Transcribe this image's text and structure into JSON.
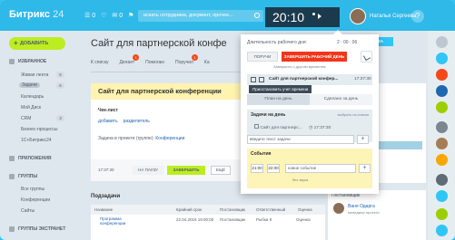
{
  "header": {
    "logo": "Битрикс",
    "logo_num": "24",
    "icons": [
      "☰ 0",
      "♡",
      "✉ 0",
      "⚑"
    ],
    "search_placeholder": "искать сотрудника, документ, прочее...",
    "clock": "20:10",
    "user_name": "Наталья Сергеева",
    "help": "?"
  },
  "sidebar": {
    "add_label": "ДОБАВИТЬ",
    "favorites": "ИЗБРАННОЕ",
    "items": [
      {
        "label": "Живая лента",
        "badge": "5"
      },
      {
        "label": "Задачи",
        "badge": "6"
      },
      {
        "label": "Календарь",
        "badge": ""
      },
      {
        "label": "Мой Диск",
        "badge": ""
      },
      {
        "label": "CRM",
        "badge": "3"
      },
      {
        "label": "Бизнес-процессы",
        "badge": ""
      },
      {
        "label": "1С+Битрикс24",
        "badge": ""
      }
    ],
    "apps": "ПРИЛОЖЕНИЯ",
    "groups": "ГРУППЫ",
    "group_items": [
      "Все группы",
      "Конференции",
      "Сайты"
    ],
    "extranet": "ГРУППЫ ЭКСТРАНЕТ"
  },
  "main": {
    "title": "Сайт для партнерской конфе",
    "tabs": [
      {
        "label": "К списку",
        "count": ""
      },
      {
        "label": "Делает",
        "count": "1"
      },
      {
        "label": "Помогаю",
        "count": ""
      },
      {
        "label": "Поручил",
        "count": "1"
      },
      {
        "label": "Ка",
        "count": ""
      }
    ],
    "task_title": "Сайт для партнерской конференции",
    "checklist": "Чек-лист",
    "add_link": "добавить",
    "separator_link": "разделитель",
    "project_label": "Задача в проекте (группе):",
    "project_name": "Конференции",
    "timer": "17:37:30",
    "pause": "НА ПАУЗУ",
    "finish": "ЗАВЕРШИТЬ",
    "more": "ЕЩЁ",
    "subtasks": "Подзадачи",
    "grid_headers": [
      "Название",
      "Крайний срок",
      "Постановщик",
      "Ответственный",
      "Оценка"
    ],
    "grid_row": {
      "name": "Программа конференции",
      "deadline": "22.04.2016 19:00:00",
      "creator": "Постановщик",
      "assignee": "Рыбка К",
      "score": "Оценка"
    }
  },
  "right": {
    "button": "ЗА",
    "stage": "Ждёт выполнения",
    "creator_label": "Постановщик",
    "creator_name": "Ваня Одарга",
    "creator_role": "менеджер проекта"
  },
  "popup": {
    "duration_label": "Длительность рабочего дня:",
    "duration_value": "2 : 00 : 06",
    "pause": "ПОРУЧИ",
    "finish": "ЗАВЕРШИТЬ РАБОЧИЙ ДЕНЬ",
    "note": "Завершить с другим временем",
    "current_task": "Сайт для партнерской конфер...",
    "current_time": "17:37:30",
    "tooltip": "Приостановить учет времени",
    "tab_plan": "План на день",
    "tab_done": "Сделано за день",
    "tasks_header": "Задачи на день",
    "tasks_select": "выбрать из списка",
    "task_item": "Сайт для партнерс...",
    "task_item_time": "17:37:30",
    "task_input": "введите текст задачи",
    "events_header": "События",
    "ev_from": "21:00",
    "ev_to": "22:00",
    "ev_input": "новое событие",
    "ev_check": "без звука",
    "plus": "+"
  }
}
